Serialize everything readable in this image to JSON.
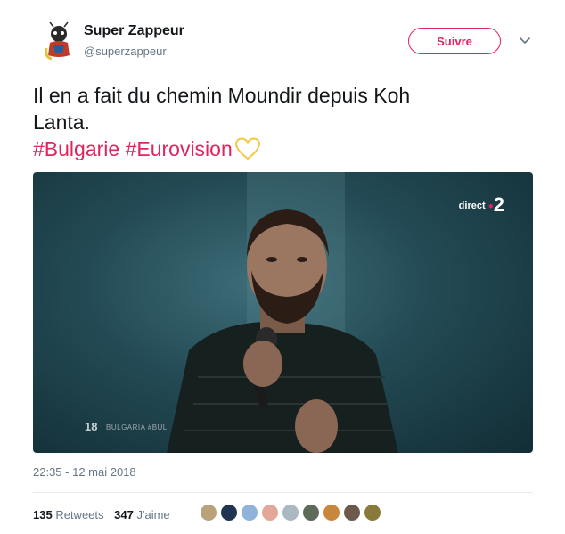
{
  "author": {
    "name": "Super Zappeur",
    "handle": "@superzappeur"
  },
  "follow_button": {
    "label": "Suivre",
    "color": "#e0245e"
  },
  "tweet": {
    "text_line1": "Il en a fait du chemin Moundir depuis Koh",
    "text_line2": "Lanta.",
    "hashtags": "#Bulgarie #Eurovision",
    "emoji": "yellow-heart-icon"
  },
  "media": {
    "channel_label": "direct",
    "channel_number": "2",
    "overlay_number": "18",
    "overlay_country": "BULGARIA #BUL"
  },
  "timestamp": "22:35 - 12 mai 2018",
  "stats": {
    "retweets_count": "135",
    "retweets_label": "Retweets",
    "likes_count": "347",
    "likes_label": "J'aime"
  },
  "likers": [
    {
      "color": "#b9a27a"
    },
    {
      "color": "#1f3552"
    },
    {
      "color": "#8fb3d9"
    },
    {
      "color": "#e3a79a"
    },
    {
      "color": "#aab8c2"
    },
    {
      "color": "#5e6b5a"
    },
    {
      "color": "#c9873e"
    },
    {
      "color": "#6d5a4c"
    },
    {
      "color": "#8a7a3a"
    }
  ]
}
